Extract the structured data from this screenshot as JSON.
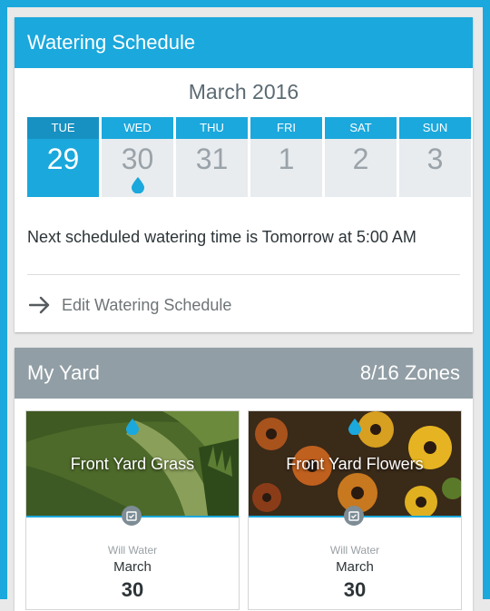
{
  "watering": {
    "title": "Watering Schedule",
    "month": "March 2016",
    "days": [
      {
        "dow": "TUE",
        "num": "29",
        "today": true,
        "water": false
      },
      {
        "dow": "WED",
        "num": "30",
        "today": false,
        "water": true
      },
      {
        "dow": "THU",
        "num": "31",
        "today": false,
        "water": false
      },
      {
        "dow": "FRI",
        "num": "1",
        "today": false,
        "water": false
      },
      {
        "dow": "SAT",
        "num": "2",
        "today": false,
        "water": false
      },
      {
        "dow": "SUN",
        "num": "3",
        "today": false,
        "water": false
      }
    ],
    "next_text": "Next scheduled watering time is Tomorrow at 5:00 AM",
    "edit_label": "Edit Watering Schedule",
    "accent": "#1ba8dc"
  },
  "yard": {
    "title": "My Yard",
    "zones_count": "8/16 Zones",
    "zones": [
      {
        "name": "Front Yard Grass",
        "will": "Will Water",
        "month": "March",
        "day": "30",
        "icon": "water-drop-icon"
      },
      {
        "name": "Front Yard Flowers",
        "will": "Will Water",
        "month": "March",
        "day": "30",
        "icon": "water-drop-icon"
      }
    ],
    "header_color": "#919ea5"
  }
}
